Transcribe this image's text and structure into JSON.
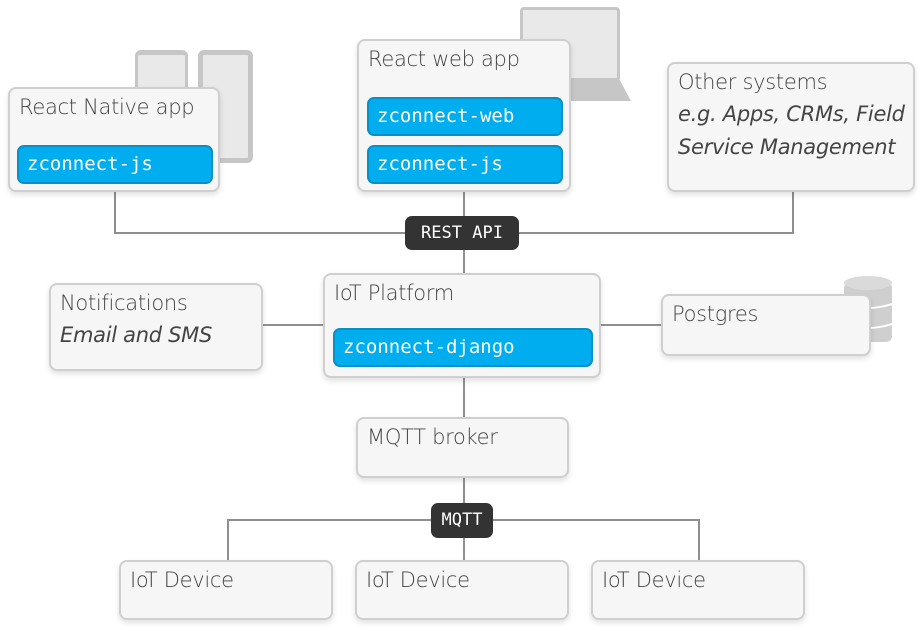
{
  "react_native": {
    "title": "React Native app",
    "tag": "zconnect-js"
  },
  "react_web": {
    "title": "React web app",
    "tags": [
      "zconnect-web",
      "zconnect-js"
    ]
  },
  "other": {
    "title": "Other systems",
    "subtitle_lines": [
      "e.g. Apps, CRMs, Field",
      "Service Management"
    ]
  },
  "rest_badge": "REST API",
  "notifications": {
    "title": "Notifications",
    "subtitle": "Email and SMS"
  },
  "platform": {
    "title": "IoT Platform",
    "tag": "zconnect-django"
  },
  "postgres": {
    "title": "Postgres"
  },
  "broker": {
    "title": "MQTT broker"
  },
  "mqtt_badge": "MQTT",
  "devices": [
    "IoT Device",
    "IoT Device",
    "IoT Device"
  ],
  "colors": {
    "tag": "#00adee",
    "badge": "#333333",
    "box": "#f6f6f6",
    "line": "#8f8f8f"
  }
}
